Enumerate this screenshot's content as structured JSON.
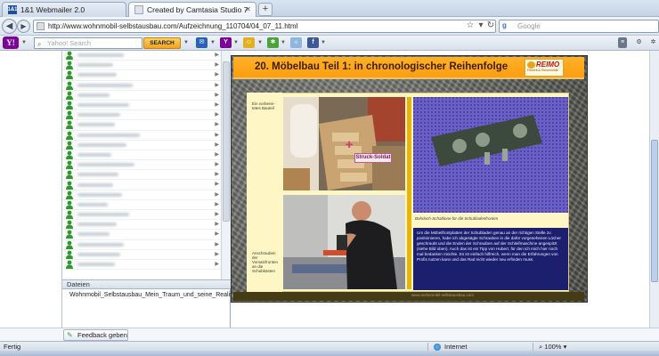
{
  "tabs": [
    {
      "label": "1&1 Webmailer 2.0",
      "active": false
    },
    {
      "label": "Created by Camtasia Studio 7",
      "active": true
    }
  ],
  "newtab_label": "+",
  "nav": {
    "back_icon": "back-arrow-icon",
    "forward_icon": "forward-arrow-icon",
    "url": "http://www.wohnmobil-selbstausbau.com/Aufzeichnung_110704/04_07_11.html",
    "search_placeholder": "Google"
  },
  "yahoo_toolbar": {
    "logo": "Y!",
    "search_placeholder": "Yahoo! Search",
    "search_button": "SEARCH"
  },
  "contacts": {
    "count": 22,
    "name_widths": [
      52,
      40,
      44,
      62,
      36,
      58,
      48,
      42,
      70,
      55,
      38,
      64,
      46,
      40,
      50,
      34,
      58,
      44,
      36,
      52,
      48,
      42
    ]
  },
  "files": {
    "header": "Dateien",
    "item": "Wohnmobil_Selbstausbau_Mein_Traum_und_seine_Realisat"
  },
  "slide": {
    "title": "20. Möbelbau Teil 1: in chronologischer Reihenfolge",
    "logo_text": "REIMO",
    "logo_subtext": "Freizeit-& Reisemobile",
    "left_caption_top": "Ein vorberei-tetes Bauteil",
    "left_caption_bottom": "Anschrauben der Vorsatzfronten an die Schubkästen",
    "callout": "Struck-Soldat",
    "photo3_caption": "Bohrloch-Schablone für die Schubladenfronten",
    "body_text": "Um die Möbelfrontplatten der Schubladen genau an der richtigen Stelle zu positionieren, habe ich abgesägte Schrauben in die dafür vorgesehenen Löcher geschraubt und die Enden der Schrauben auf der Schleifmaschine angespitzt (siehe Bild oben). Auch das ist ein Tipp von Hubert, für den ich mich hier noch mal bedanken möchte. Es ist einfach hilfreich, wenn man die Erfahrungen von Profis nutzen kann und das Rad nicht wieder neu erfinden muss.",
    "footer": "www.wohnmobil-selbstausbau.com"
  },
  "feedback_button": "Feedback geben",
  "status": {
    "text": "Fertig",
    "zone": "Internet",
    "zoom": "100%"
  },
  "colors": {
    "title_bg": "#ff9d10",
    "slide_bg": "#fff6c6",
    "text_panel": "#1c1f6e",
    "yahoo_purple": "#7b0099",
    "contact_green": "#2e9a2c"
  }
}
